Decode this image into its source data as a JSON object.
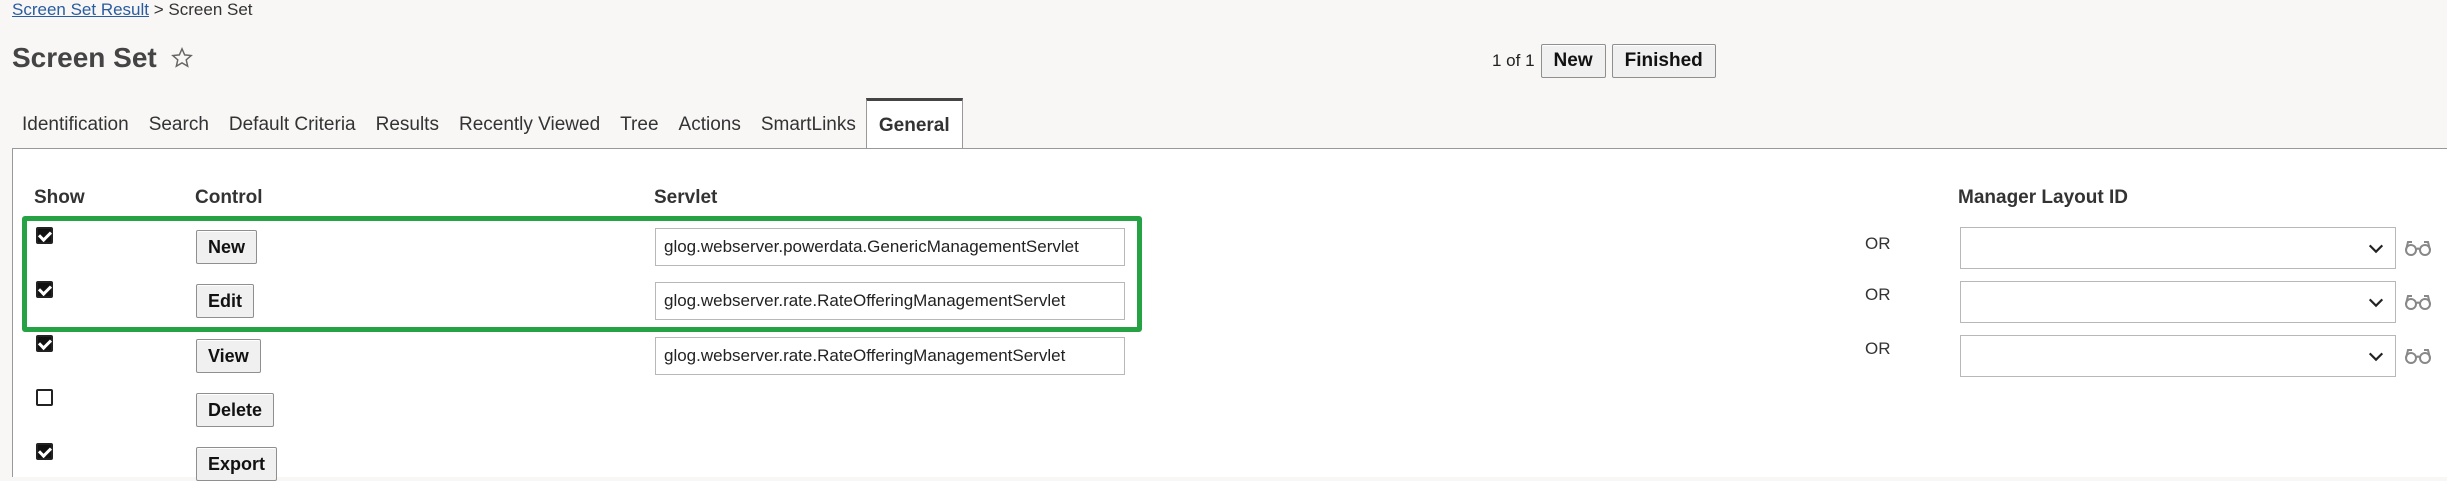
{
  "breadcrumb": {
    "link": "Screen Set Result",
    "separator": ">",
    "current": "Screen Set"
  },
  "page": {
    "title": "Screen Set"
  },
  "paging": {
    "count": "1 of 1",
    "new_label": "New",
    "finished_label": "Finished"
  },
  "tabs": [
    {
      "label": "Identification"
    },
    {
      "label": "Search"
    },
    {
      "label": "Default Criteria"
    },
    {
      "label": "Results"
    },
    {
      "label": "Recently Viewed"
    },
    {
      "label": "Tree"
    },
    {
      "label": "Actions"
    },
    {
      "label": "SmartLinks"
    },
    {
      "label": "General",
      "active": true
    }
  ],
  "table": {
    "headers": {
      "show": "Show",
      "control": "Control",
      "servlet": "Servlet",
      "layout": "Manager Layout ID"
    },
    "rows": [
      {
        "show": true,
        "control": "New",
        "servlet": "glog.webserver.powerdata.GenericManagementServlet",
        "or": "OR",
        "layout": ""
      },
      {
        "show": true,
        "control": "Edit",
        "servlet": "glog.webserver.rate.RateOfferingManagementServlet",
        "or": "OR",
        "layout": ""
      },
      {
        "show": true,
        "control": "View",
        "servlet": "glog.webserver.rate.RateOfferingManagementServlet",
        "or": "OR",
        "layout": ""
      },
      {
        "show": false,
        "control": "Delete"
      },
      {
        "show": true,
        "control": "Export"
      }
    ]
  },
  "colors": {
    "highlight": "#25a244",
    "link": "#2a5d9f"
  }
}
